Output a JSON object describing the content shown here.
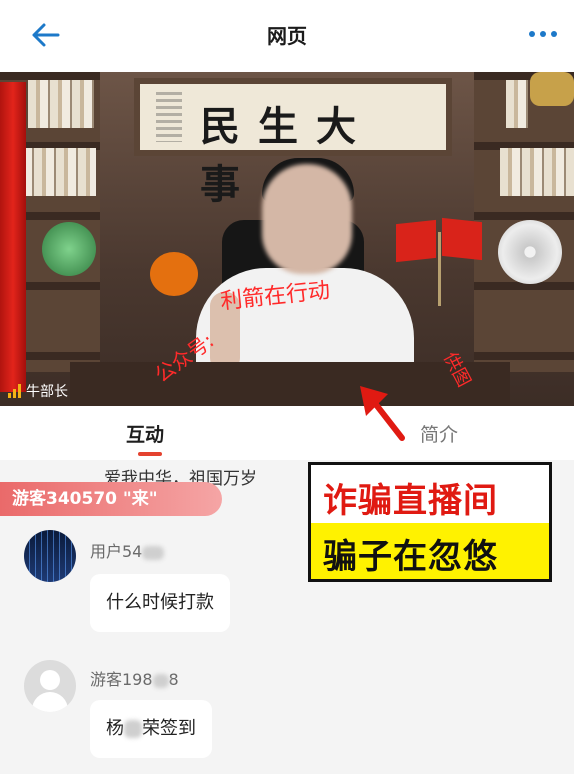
{
  "header": {
    "title": "网页",
    "back_icon": "back-arrow-icon",
    "more_icon": "more-dots-icon"
  },
  "video": {
    "calligraphy": "民生大事",
    "watermark_a": "公众号:",
    "watermark_b": "利箭在行动",
    "watermark_c": "供图",
    "host_name": "牛部长"
  },
  "tabs": {
    "interact": "互动",
    "intro": "简介"
  },
  "chat": {
    "ticker": "爱我中华，祖国万岁",
    "visitor_banner": "游客340570 \"来\"",
    "messages": [
      {
        "user": "用户54",
        "text": "什么时候打款"
      },
      {
        "user_pre": "游客198",
        "user_post": "8",
        "text_pre": "杨",
        "text_post": "荣签到"
      }
    ]
  },
  "annotation": {
    "line1": "诈骗直播间",
    "line2": "骗子在忽悠"
  },
  "colors": {
    "accent": "#e4422f",
    "back_arrow": "#1d79c9",
    "annotation_red": "#e01a12",
    "annotation_yellow": "#fff200"
  }
}
